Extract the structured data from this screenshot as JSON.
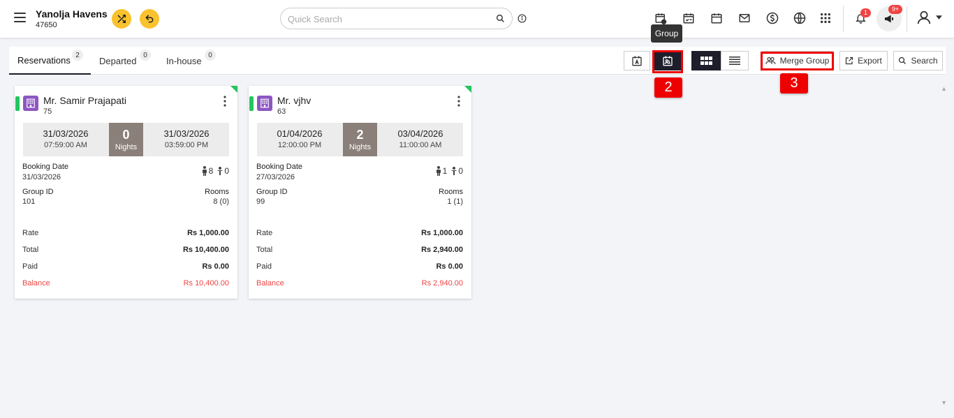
{
  "header": {
    "hotel_name": "Yanolja Havens",
    "hotel_id": "47650",
    "search_placeholder": "Quick Search",
    "notif_count": "1",
    "announcement_count": "9+"
  },
  "toolbar": {
    "tabs": [
      {
        "label": "Reservations",
        "count": "2"
      },
      {
        "label": "Departed",
        "count": "0"
      },
      {
        "label": "In-house",
        "count": "0"
      }
    ],
    "tooltip": "Group",
    "merge_group_label": "Merge Group",
    "export_label": "Export",
    "search_label": "Search",
    "step2": "2",
    "step3": "3"
  },
  "cards": [
    {
      "name": "Mr. Samir Prajapati",
      "number": "75",
      "arrival_date": "31/03/2026",
      "arrival_time": "07:59:00 AM",
      "nights": "0",
      "nights_label": "Nights",
      "departure_date": "31/03/2026",
      "departure_time": "03:59:00 PM",
      "booking_date_label": "Booking Date",
      "booking_date": "31/03/2026",
      "adults": "8",
      "children": "0",
      "group_id_label": "Group ID",
      "group_id": "101",
      "rooms_label": "Rooms",
      "rooms": "8 (0)",
      "rate_label": "Rate",
      "rate": "Rs 1,000.00",
      "total_label": "Total",
      "total": "Rs 10,400.00",
      "paid_label": "Paid",
      "paid": "Rs 0.00",
      "balance_label": "Balance",
      "balance": "Rs 10,400.00"
    },
    {
      "name": "Mr. vjhv",
      "number": "63",
      "arrival_date": "01/04/2026",
      "arrival_time": "12:00:00 PM",
      "nights": "2",
      "nights_label": "Nights",
      "departure_date": "03/04/2026",
      "departure_time": "11:00:00 AM",
      "booking_date_label": "Booking Date",
      "booking_date": "27/03/2026",
      "adults": "1",
      "children": "0",
      "group_id_label": "Group ID",
      "group_id": "99",
      "rooms_label": "Rooms",
      "rooms": "1 (1)",
      "rate_label": "Rate",
      "rate": "Rs 1,000.00",
      "total_label": "Total",
      "total": "Rs 2,940.00",
      "paid_label": "Paid",
      "paid": "Rs 0.00",
      "balance_label": "Balance",
      "balance": "Rs 2,940.00"
    }
  ],
  "colors": {
    "accent_yellow": "#f9c22e",
    "annotation_red": "#ee0000",
    "status_green": "#22c55e",
    "balance_red": "#ef4444",
    "nights_grey": "#8a7f79"
  }
}
